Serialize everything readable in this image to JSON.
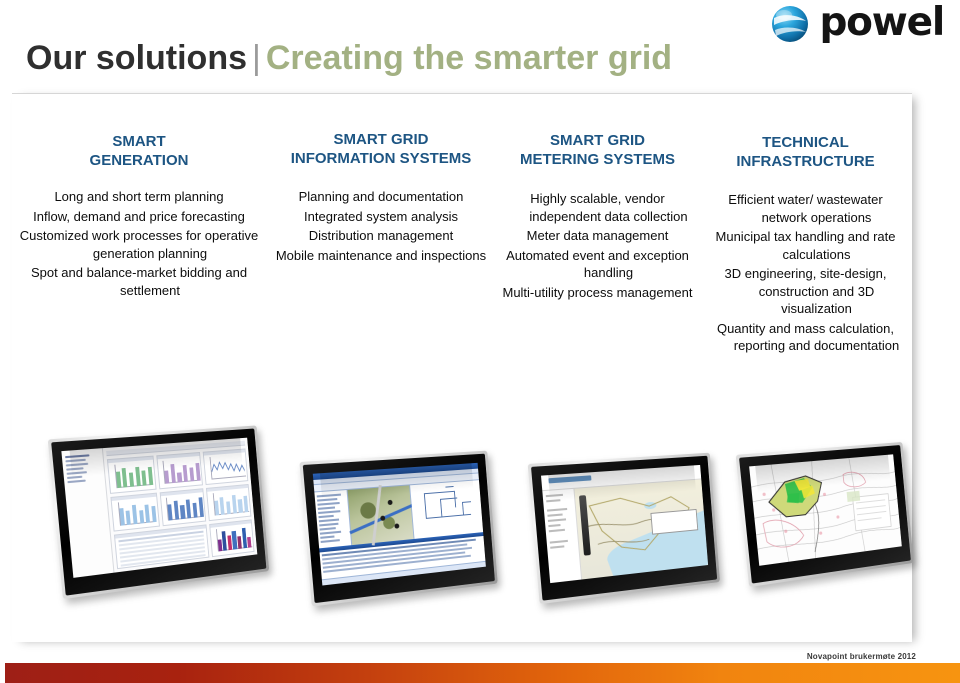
{
  "header": {
    "title_primary": "Our solutions",
    "title_separator": "|",
    "title_secondary": "Creating the smarter grid",
    "logo_wordmark": "powel",
    "logo_mark_name": "powel-sphere-logo",
    "colors": {
      "title_primary": "#2f2f2f",
      "title_secondary": "#a3b183",
      "logo_blue": "#1d9cd3"
    }
  },
  "columns": [
    {
      "heading": "SMART\nGENERATION",
      "items": [
        "Long and short term planning",
        "Inflow, demand and price forecasting",
        "Customized work processes for operative generation planning",
        "Spot and balance-market bidding and settlement"
      ]
    },
    {
      "heading": "SMART GRID\nINFORMATION SYSTEMS",
      "items": [
        "Planning and documentation",
        "Integrated system analysis",
        "Distribution management",
        "Mobile maintenance and inspections"
      ]
    },
    {
      "heading": "SMART GRID\nMETERING SYSTEMS",
      "items": [
        "Highly scalable, vendor independent data collection",
        "Meter data management",
        "Automated event and exception handling",
        "Multi-utility process management"
      ]
    },
    {
      "heading": "TECHNICAL\nINFRASTRUCTURE",
      "items": [
        "Efficient water/ wastewater network operations",
        "Municipal tax handling and rate calculations",
        "3D engineering, site-design, construction and 3D visualization",
        "Quantity and mass calculation, reporting and documentation"
      ]
    }
  ],
  "monitors": [
    {
      "name": "monitor-smart-generation-dashboard",
      "caption": ""
    },
    {
      "name": "monitor-grid-information-gis",
      "caption": ""
    },
    {
      "name": "monitor-metering-web-map",
      "caption": ""
    },
    {
      "name": "monitor-technical-infrastructure-cad",
      "caption": ""
    }
  ],
  "footer": {
    "label": "Novapoint brukermøte 2012",
    "bar_color_start": "#9e1f16",
    "bar_color_end": "#f79410"
  },
  "theme": {
    "heading_blue": "#1d5583",
    "body_text": "#0d0d0d",
    "panel_background": "#ffffff"
  }
}
